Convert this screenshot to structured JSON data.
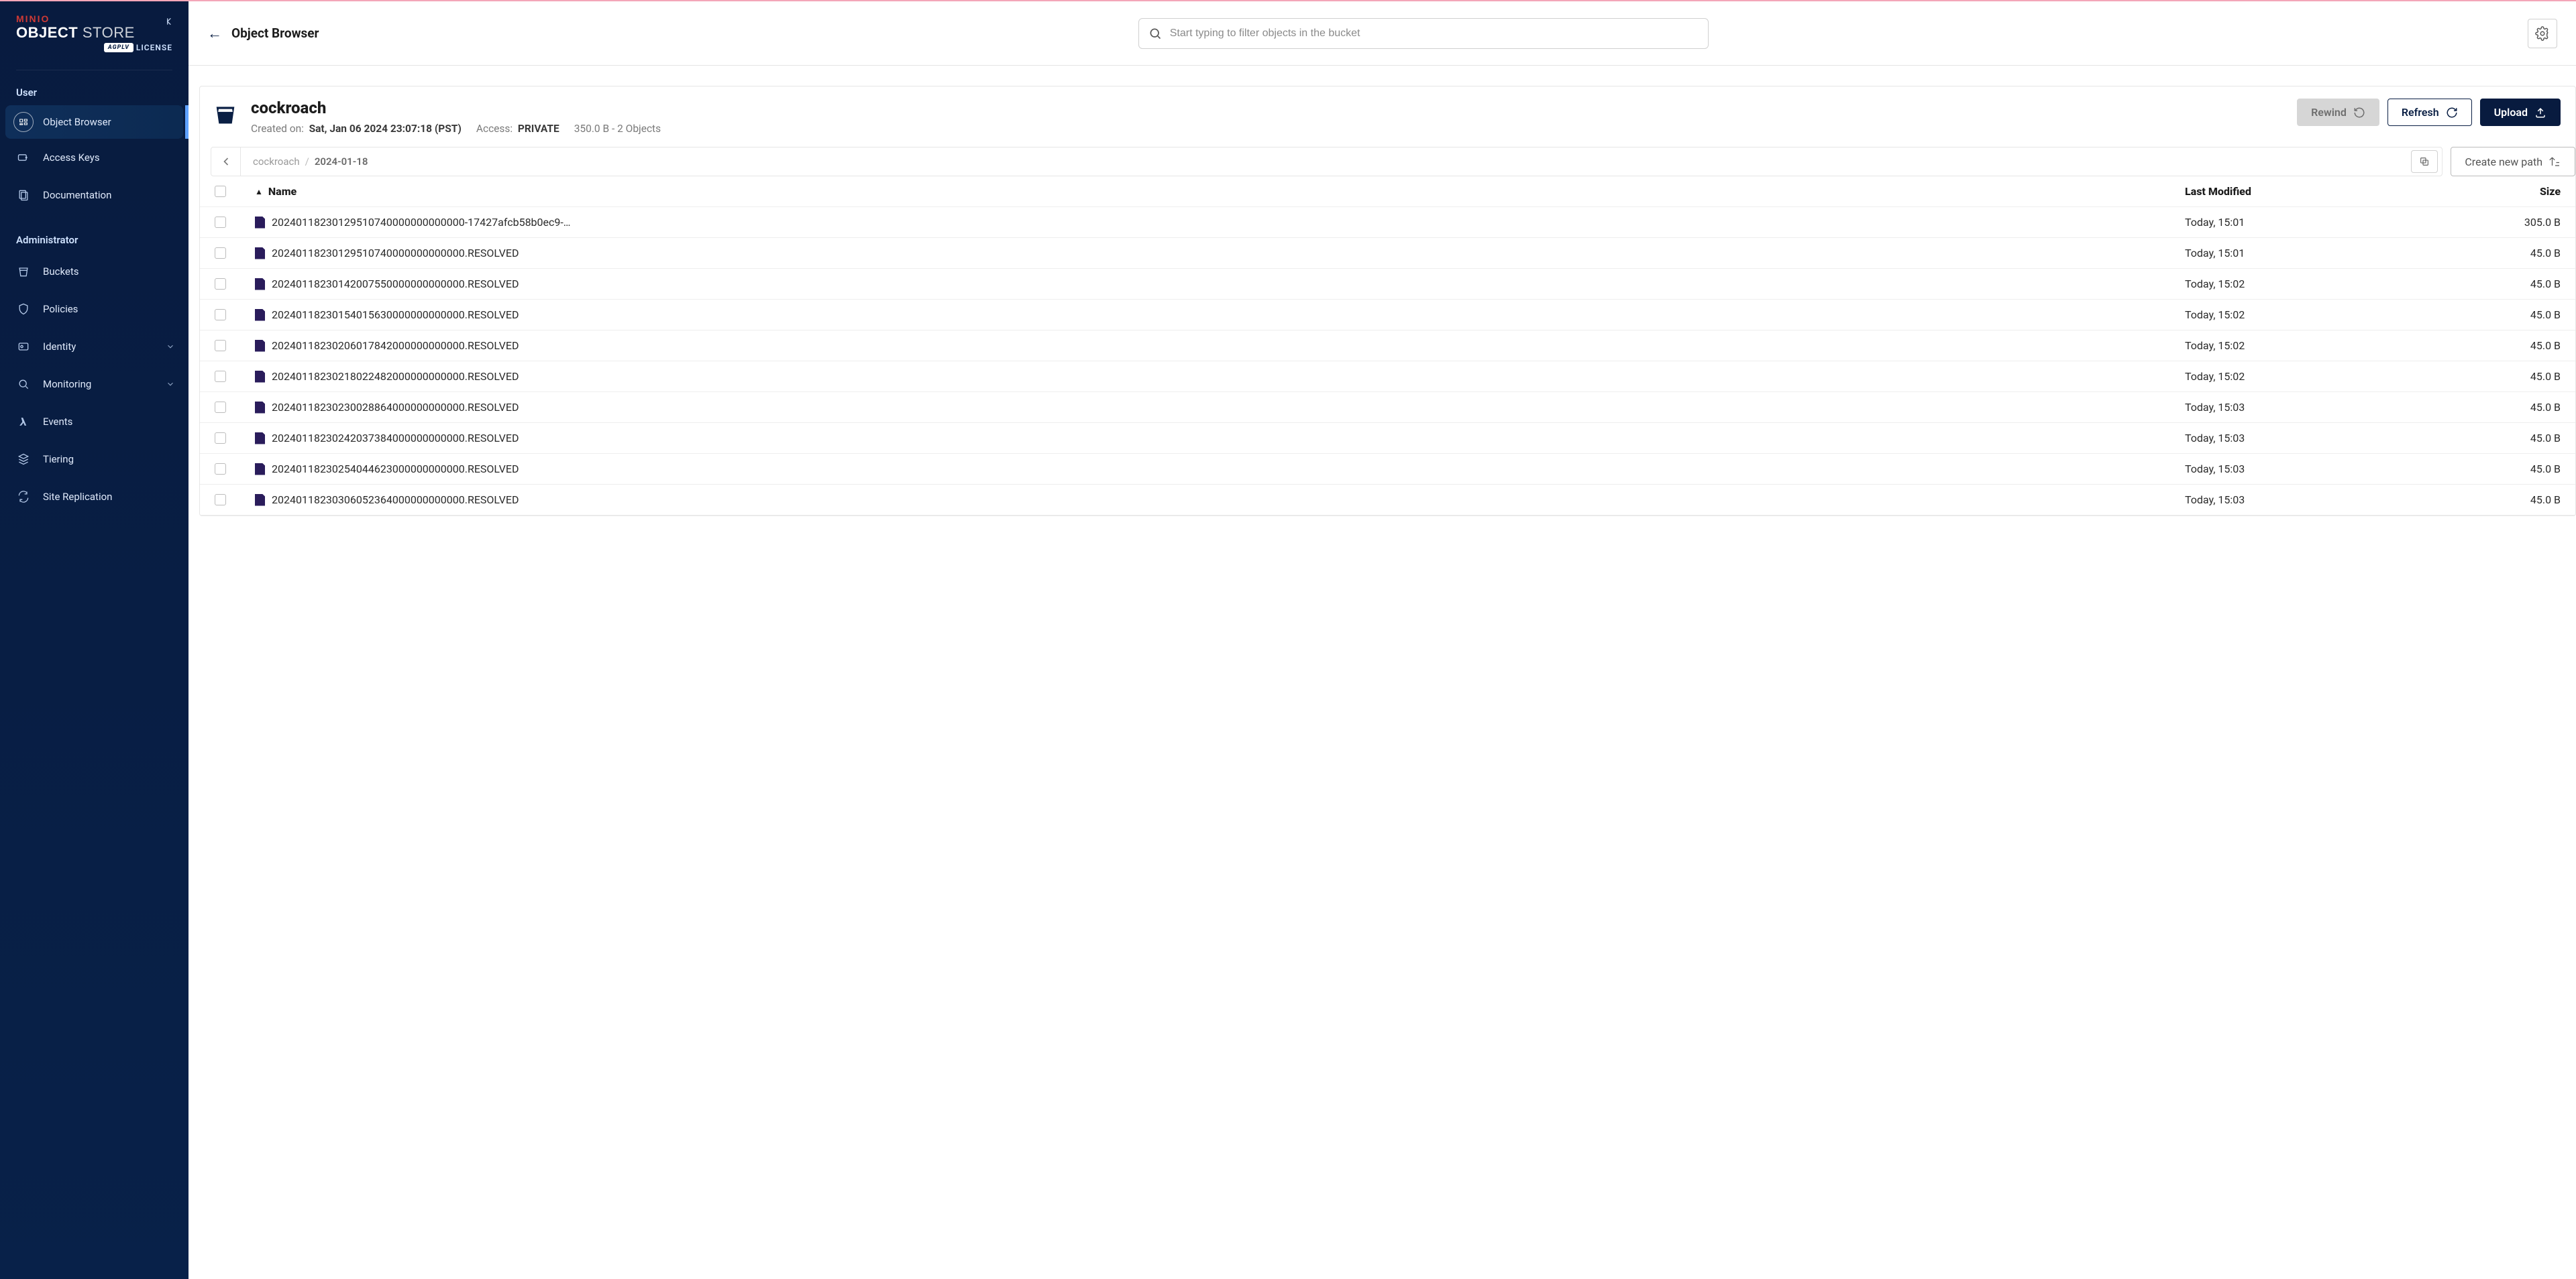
{
  "branding": {
    "minio": "MINIO",
    "object": "OBJECT",
    "store": "STORE",
    "agpl": "AGPLV",
    "license": "LICENSE"
  },
  "sidebar": {
    "section_user": "User",
    "section_admin": "Administrator",
    "items": {
      "object_browser": "Object Browser",
      "access_keys": "Access Keys",
      "documentation": "Documentation",
      "buckets": "Buckets",
      "policies": "Policies",
      "identity": "Identity",
      "monitoring": "Monitoring",
      "events": "Events",
      "tiering": "Tiering",
      "site_replication": "Site Replication"
    }
  },
  "topbar": {
    "title": "Object Browser",
    "search_placeholder": "Start typing to filter objects in the bucket"
  },
  "bucket": {
    "name": "cockroach",
    "created_label": "Created on:",
    "created_value": "Sat, Jan 06 2024 23:07:18 (PST)",
    "access_label": "Access:",
    "access_value": "PRIVATE",
    "summary": "350.0 B - 2 Objects",
    "buttons": {
      "rewind": "Rewind",
      "refresh": "Refresh",
      "upload": "Upload"
    }
  },
  "breadcrumb": {
    "parts": [
      "cockroach",
      "2024-01-18"
    ],
    "create_new_path": "Create new path"
  },
  "table": {
    "headers": {
      "name": "Name",
      "last_modified": "Last Modified",
      "size": "Size"
    },
    "rows": [
      {
        "name": "20240118230129510740000000000000-17427afcb58b0ec9-…",
        "modified": "Today, 15:01",
        "size": "305.0 B"
      },
      {
        "name": "20240118230129510740000000000000.RESOLVED",
        "modified": "Today, 15:01",
        "size": "45.0 B"
      },
      {
        "name": "20240118230142007550000000000000.RESOLVED",
        "modified": "Today, 15:02",
        "size": "45.0 B"
      },
      {
        "name": "20240118230154015630000000000000.RESOLVED",
        "modified": "Today, 15:02",
        "size": "45.0 B"
      },
      {
        "name": "20240118230206017842000000000000.RESOLVED",
        "modified": "Today, 15:02",
        "size": "45.0 B"
      },
      {
        "name": "20240118230218022482000000000000.RESOLVED",
        "modified": "Today, 15:02",
        "size": "45.0 B"
      },
      {
        "name": "20240118230230028864000000000000.RESOLVED",
        "modified": "Today, 15:03",
        "size": "45.0 B"
      },
      {
        "name": "20240118230242037384000000000000.RESOLVED",
        "modified": "Today, 15:03",
        "size": "45.0 B"
      },
      {
        "name": "20240118230254044623000000000000.RESOLVED",
        "modified": "Today, 15:03",
        "size": "45.0 B"
      },
      {
        "name": "20240118230306052364000000000000.RESOLVED",
        "modified": "Today, 15:03",
        "size": "45.0 B"
      }
    ]
  }
}
